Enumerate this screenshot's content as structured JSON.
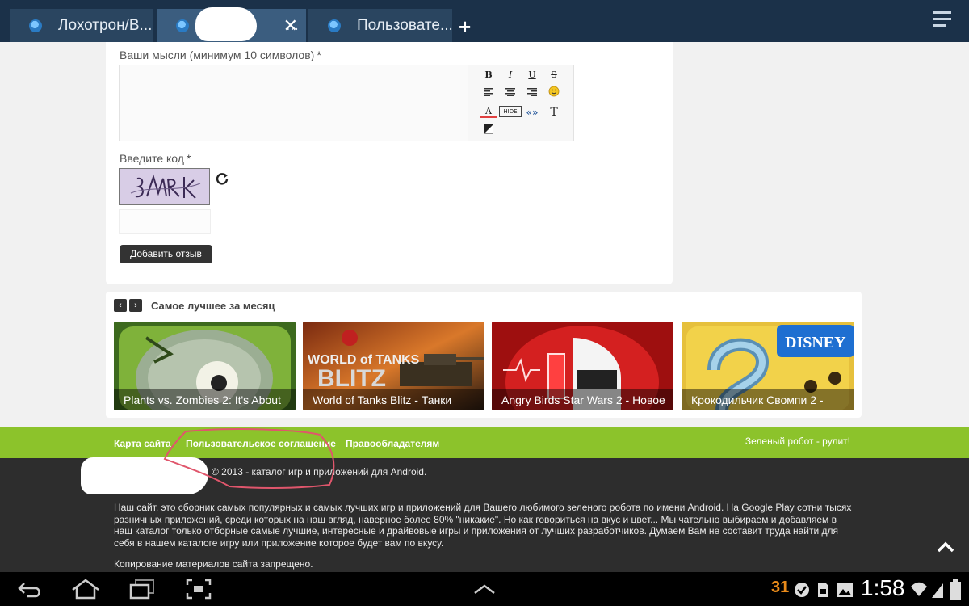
{
  "browser": {
    "tabs": [
      {
        "label": "Лохотрон/В...",
        "active": false
      },
      {
        "label": "...",
        "active": true
      },
      {
        "label": "Пользовате...",
        "active": false
      }
    ],
    "close_label": "✕",
    "newtab_label": "+"
  },
  "form": {
    "thoughts_label": "Ваши мысли (минимум 10 символов)",
    "required_mark": "*",
    "code_label": "Введите код",
    "submit_label": "Добавить отзыв",
    "toolbar": [
      "B",
      "I",
      "U",
      "S",
      "align-left",
      "align-center",
      "align-right",
      "smiley",
      "A",
      "HIDE",
      "«»",
      "T",
      "color"
    ]
  },
  "best": {
    "title": "Самое лучшее за месяц",
    "prev_label": "‹",
    "next_label": "›",
    "items": [
      {
        "caption": "Plants vs. Zombies 2: It's About"
      },
      {
        "caption": "World of Tanks Blitz - Танки"
      },
      {
        "caption": "Angry Birds Star Wars 2 - Новое"
      },
      {
        "caption": "Крокодильчик Свомпи 2 -"
      }
    ],
    "wot_logo": "WORLD of TANKS",
    "wot_sub": "BLITZ",
    "disney_logo": "DISNEY"
  },
  "footer": {
    "links": [
      "Карта сайта",
      "Пользовательское соглашение",
      "Правообладателям"
    ],
    "slogan": "Зеленый робот - рулит!",
    "copyright": "© 2013 - каталог игр и приложений для Android.",
    "about": "Наш сайт, это сборник самых популярных и самых лучших игр и приложений для Вашего любимого зеленого робота по имени Android. На Google Play сотни тысях разничных приложений, среди которых на наш вгляд, наверное более 80% \"никакие\". Но как говориться на вкус и цвет... Мы чательно выбираем и добавляем в наш каталог только отборные самые лучшие, интересные и драйвовые игры и приложения от лучших разработчиков. Думаем Вам не составит труда найти для себя в нашем каталоге игру или приложение которое будет вам по вкусу.",
    "copy_warning": "Копирование материалов сайта запрещено."
  },
  "statusbar": {
    "calendar": "31",
    "clock": "1:58"
  },
  "colors": {
    "tabbar": "#1b3149",
    "green": "#8cc32b",
    "footer": "#2d2d2d"
  }
}
